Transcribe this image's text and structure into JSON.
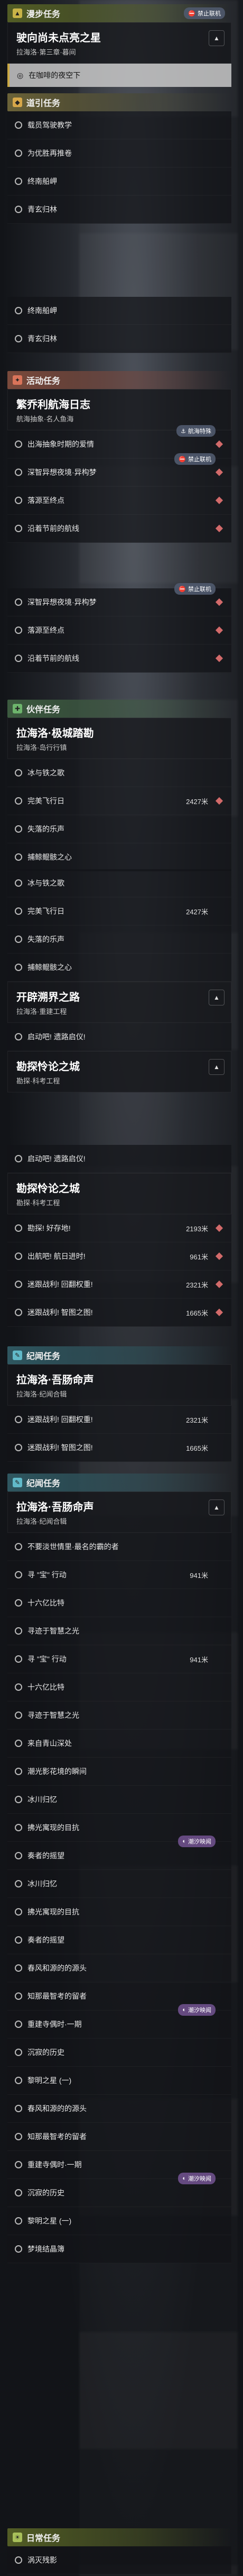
{
  "sections": {
    "explore": {
      "header": "漫步任务",
      "mission_title": "驶向尚未点亮之星",
      "mission_sub": "拉海洛·第三章·暮间",
      "selected": "在咖啡的夜空下"
    },
    "path": {
      "header": "道引任务",
      "items": [
        "载员驾驶教学",
        "为优胜再推卷",
        "终南船岬",
        "青玄归林"
      ]
    },
    "path2": {
      "items": [
        "终南船岬",
        "青玄归林"
      ]
    },
    "activity": {
      "header": "活动任务",
      "title": "繁乔利航海日志",
      "sub": "航海抽象·名人鱼海",
      "items": [
        "出海抽象时期的爱情",
        "深智异想夜境·异构梦",
        "落源至终点",
        "沿着节前的航线"
      ],
      "badge1": "航海特殊",
      "badge2": "禁止联机",
      "items_repeat": [
        "深智异想夜境·异构梦",
        "落源至终点",
        "沿着节前的航线"
      ]
    },
    "company": {
      "header": "伙伴任务",
      "title": "拉海洛·极城踏勘",
      "sub": "拉海洛·岛行行镇",
      "items": [
        {
          "label": "冰与铁之歌",
          "dist": ""
        },
        {
          "label": "完美飞行日",
          "dist": "2427米"
        },
        {
          "label": "失落的乐声",
          "dist": ""
        },
        {
          "label": "捕鲸鲲骸之心",
          "dist": ""
        }
      ]
    },
    "company2": {
      "items": [
        {
          "label": "冰与铁之歌",
          "dist": ""
        },
        {
          "label": "完美飞行日",
          "dist": "2427米"
        },
        {
          "label": "失落的乐声",
          "dist": ""
        },
        {
          "label": "捕鲸鲲骸之心",
          "dist": ""
        }
      ],
      "world_title": "开辟溯界之路",
      "world_sub": "拉海洛·重建工程",
      "world_item": "启动吧! 遗路启仪!",
      "relic_title": "勘探怜论之城",
      "relic_sub": "勘探·科考工程"
    },
    "relic": {
      "item0": "启动吧! 遗路启仪!",
      "title": "勘探怜论之城",
      "sub": "勘探·科考工程",
      "items": [
        {
          "label": "勘探! 好存地!",
          "dist": "2193米"
        },
        {
          "label": "出航吧! 航日进时!",
          "dist": "961米"
        },
        {
          "label": "迷跟战利! 回翻权重!",
          "dist": "2321米"
        },
        {
          "label": "迷跟战利! 智图之图!",
          "dist": "1665米"
        }
      ]
    },
    "record": {
      "header": "纪闻任务",
      "title": "拉海洛·吾肠命声",
      "sub": "拉海洛·纪闻合辑",
      "rows_top": [
        {
          "label": "迷跟战利! 回翻权重!",
          "dist": "2321米"
        },
        {
          "label": "迷跟战利! 智图之图!",
          "dist": "1665米"
        }
      ],
      "items": [
        {
          "label": "不要淡世情里·最名的霸的者",
          "dist": ""
        },
        {
          "label": "寻 \"宝\" 行动",
          "dist": "941米"
        },
        {
          "label": "十六亿比特",
          "dist": ""
        },
        {
          "label": "寻迹于智慧之光",
          "dist": ""
        },
        {
          "label": "寻 \"宝\" 行动",
          "dist": "941米"
        },
        {
          "label": "十六亿比特",
          "dist": ""
        },
        {
          "label": "寻迹于智慧之光",
          "dist": ""
        },
        {
          "label": "来自青山深处",
          "dist": ""
        },
        {
          "label": "潮光影花境的瞬间",
          "dist": ""
        },
        {
          "label": "冰川归忆",
          "dist": ""
        },
        {
          "label": "拂光寓现的目抗",
          "dist": ""
        },
        {
          "label": "奏者的摇望",
          "dist": ""
        },
        {
          "label": "冰川归忆",
          "dist": ""
        },
        {
          "label": "拂光寓现的目抗",
          "dist": ""
        },
        {
          "label": "奏者的摇望",
          "dist": ""
        },
        {
          "label": "春风和源的的源头",
          "dist": ""
        },
        {
          "label": "知那最智考的留者",
          "dist": ""
        },
        {
          "label": "重建寺偶时·一期",
          "dist": ""
        },
        {
          "label": "沉寂的历史",
          "dist": ""
        },
        {
          "label": "黎明之星 (一)",
          "dist": ""
        },
        {
          "label": "春风和源的的源头",
          "dist": ""
        },
        {
          "label": "知那最智考的留者",
          "dist": ""
        },
        {
          "label": "重建寺偶时·一期",
          "dist": ""
        },
        {
          "label": "沉寂的历史",
          "dist": ""
        },
        {
          "label": "黎明之星 (一)",
          "dist": ""
        },
        {
          "label": "梦境结晶簿",
          "dist": ""
        }
      ],
      "badge_purple": "潮汐映闻"
    },
    "daily": {
      "header": "日常任务",
      "item": "涡灭残影"
    }
  },
  "badges": {
    "no_coop": "禁止联机"
  }
}
